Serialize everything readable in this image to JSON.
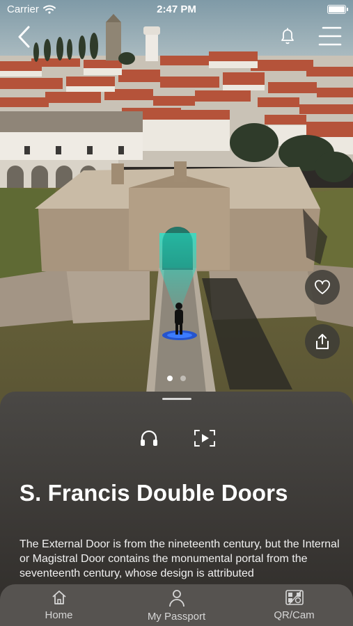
{
  "status_bar": {
    "carrier": "Carrier",
    "time": "2:47 PM"
  },
  "nav": {
    "back_icon": "chevron-left-icon",
    "notification_icon": "bell-icon",
    "menu_icon": "hamburger-menu-icon"
  },
  "actions": {
    "favorite_icon": "heart-icon",
    "share_icon": "share-icon"
  },
  "carousel": {
    "pages": 2,
    "active_page": 1
  },
  "detail": {
    "audio_icon": "headphones-icon",
    "video_icon": "video-play-icon",
    "title": "S. Francis Double Doors",
    "description": "The External Door is from the nineteenth century, but the Internal or Magistral Door contains the monumental portal from the seventeenth century, whose design is attributed"
  },
  "tabbar": {
    "tabs": [
      {
        "label": "Home",
        "icon": "home-icon"
      },
      {
        "label": "My Passport",
        "icon": "person-icon"
      },
      {
        "label": "QR/Cam",
        "icon": "qr-camera-icon"
      }
    ]
  },
  "colors": {
    "sheet_bg": "#3d3a37",
    "tabbar_bg": "#585552",
    "beam": "#2ec9b8",
    "roof": "#b5533a"
  }
}
